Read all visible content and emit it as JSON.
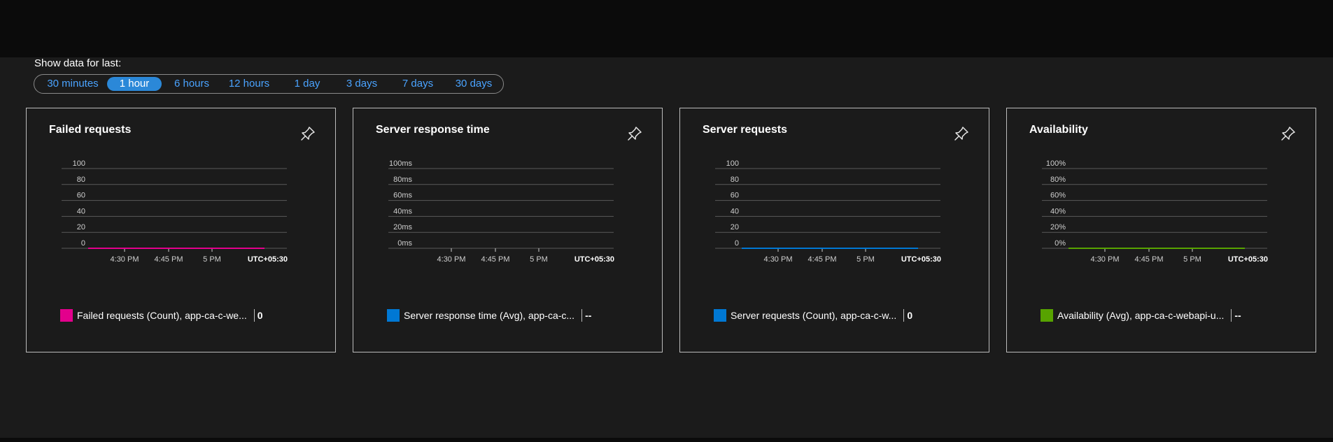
{
  "filter": {
    "label": "Show data for last:",
    "options": [
      "30 minutes",
      "1 hour",
      "6 hours",
      "12 hours",
      "1 day",
      "3 days",
      "7 days",
      "30 days"
    ],
    "selected": "1 hour"
  },
  "colors": {
    "accent": "#2b88d8",
    "failed_requests": "#e3008c",
    "server_response_time": "#0078d4",
    "server_requests": "#0078d4",
    "availability": "#57a300"
  },
  "tiles": [
    {
      "title": "Failed requests",
      "pin_icon": "pin-icon",
      "legend_label": "Failed requests (Count), app-ca-c-we...",
      "legend_value": "0",
      "color": "#e3008c",
      "chart_data": {
        "type": "line",
        "yticks": [
          "100",
          "80",
          "60",
          "40",
          "20",
          "0"
        ],
        "xticks": [
          "4:30 PM",
          "4:45 PM",
          "5 PM"
        ],
        "timezone": "UTC+05:30",
        "ylim": [
          0,
          100
        ],
        "series": [
          {
            "name": "Failed requests (Count), app-ca-c-we...",
            "values": [
              0,
              0,
              0,
              0,
              0
            ]
          }
        ]
      }
    },
    {
      "title": "Server response time",
      "pin_icon": "pin-icon",
      "legend_label": "Server response time (Avg), app-ca-c...",
      "legend_value": "--",
      "color": "#0078d4",
      "chart_data": {
        "type": "line",
        "yticks": [
          "100ms",
          "80ms",
          "60ms",
          "40ms",
          "20ms",
          "0ms"
        ],
        "xticks": [
          "4:30 PM",
          "4:45 PM",
          "5 PM"
        ],
        "timezone": "UTC+05:30",
        "ylim": [
          0,
          100
        ],
        "series": []
      }
    },
    {
      "title": "Server requests",
      "pin_icon": "pin-icon",
      "legend_label": "Server requests (Count), app-ca-c-w...",
      "legend_value": "0",
      "color": "#0078d4",
      "chart_data": {
        "type": "line",
        "yticks": [
          "100",
          "80",
          "60",
          "40",
          "20",
          "0"
        ],
        "xticks": [
          "4:30 PM",
          "4:45 PM",
          "5 PM"
        ],
        "timezone": "UTC+05:30",
        "ylim": [
          0,
          100
        ],
        "series": [
          {
            "name": "Server requests (Count), app-ca-c-w...",
            "values": [
              0,
              0,
              0,
              0,
              0
            ]
          }
        ]
      }
    },
    {
      "title": "Availability",
      "pin_icon": "pin-icon",
      "legend_label": "Availability (Avg), app-ca-c-webapi-u...",
      "legend_value": "--",
      "color": "#57a300",
      "chart_data": {
        "type": "line",
        "yticks": [
          "100%",
          "80%",
          "60%",
          "40%",
          "20%",
          "0%"
        ],
        "xticks": [
          "4:30 PM",
          "4:45 PM",
          "5 PM"
        ],
        "timezone": "UTC+05:30",
        "ylim": [
          0,
          100
        ],
        "series": [
          {
            "name": "Availability (Avg), app-ca-c-webapi-u...",
            "values": [
              0,
              0,
              0,
              0,
              0
            ]
          }
        ]
      }
    }
  ]
}
